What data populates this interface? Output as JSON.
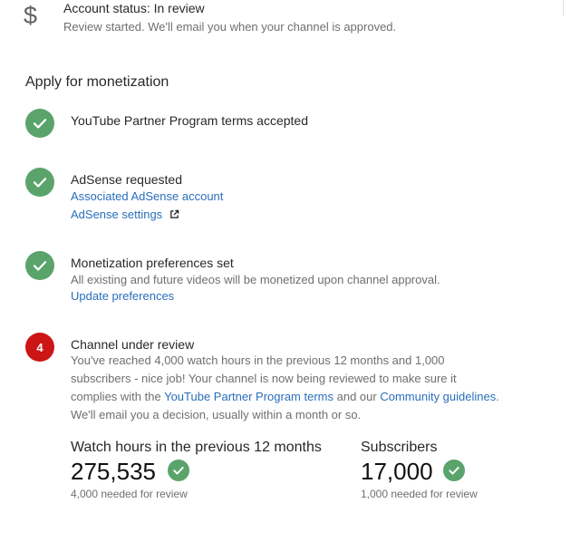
{
  "status": {
    "icon": "dollar-icon",
    "title": "Account status: In review",
    "subtitle": "Review started. We'll email you when your channel is approved."
  },
  "section_title": "Apply for monetization",
  "steps": [
    {
      "badge": "check-icon",
      "title": "YouTube Partner Program terms accepted"
    },
    {
      "badge": "check-icon",
      "title": "AdSense requested",
      "link1": "Associated AdSense account",
      "link2": "AdSense settings",
      "link2_icon": "external-link-icon"
    },
    {
      "badge": "check-icon",
      "title": "Monetization preferences set",
      "text": "All existing and future videos will be monetized upon channel approval.",
      "link1": "Update preferences"
    },
    {
      "badge_number": "4",
      "title": "Channel under review",
      "desc_part1": "You've reached 4,000 watch hours in the previous 12 months and 1,000 subscribers - nice job! Your channel is now being reviewed to make sure it complies with the ",
      "desc_link1": "YouTube Partner Program terms",
      "desc_part2": " and our ",
      "desc_link2": "Community guidelines",
      "desc_part3": ". We'll email you a decision, usually within a month or so."
    }
  ],
  "stats": {
    "watch_hours": {
      "label": "Watch hours in the previous 12 months",
      "value": "275,535",
      "note": "4,000 needed for review"
    },
    "subscribers": {
      "label": "Subscribers",
      "value": "17,000",
      "note": "1,000 needed for review"
    }
  },
  "colors": {
    "green": "#5aa46c",
    "red": "#cc1515",
    "link": "#2a6ebb"
  }
}
